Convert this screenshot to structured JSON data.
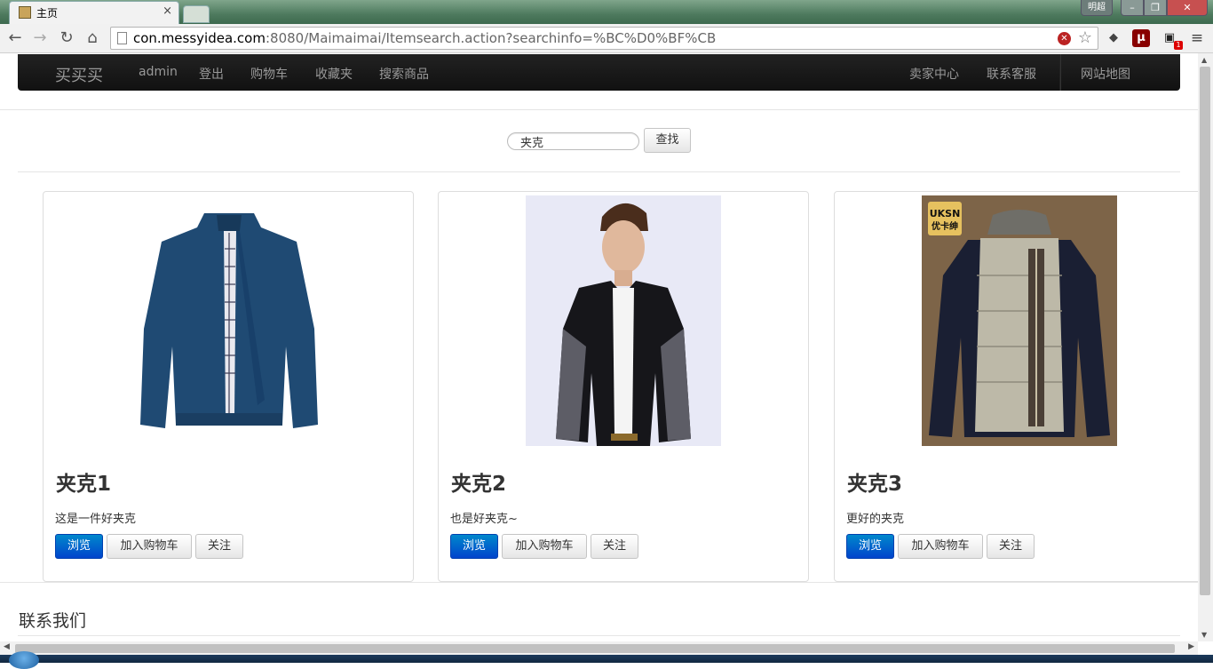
{
  "browser": {
    "tab_title": "主页",
    "tab_close": "×",
    "user_button": "明超",
    "window_min": "–",
    "window_max": "❐",
    "window_close": "✕",
    "back": "←",
    "forward": "→",
    "reload": "↻",
    "home": "⌂",
    "url_host": "con.messyidea.com",
    "url_rest": ":8080/Maimaimai/Itemsearch.action?searchinfo=%BC%D0%BF%CB",
    "ublock_label": "μ",
    "mail_badge": "1",
    "menu_glyph": "≡"
  },
  "navbar": {
    "brand": "买买买",
    "left_items": [
      "admin",
      "登出",
      "购物车",
      "收藏夹",
      "搜索商品"
    ],
    "right_items": [
      "卖家中心",
      "联系客服",
      "网站地图"
    ]
  },
  "search": {
    "value": "夹克",
    "button_label": "查找"
  },
  "products": [
    {
      "title": "夹克1",
      "description": "这是一件好夹克",
      "image": "navy-zip-jacket"
    },
    {
      "title": "夹克2",
      "description": "也是好夹克~",
      "image": "leather-jacket-model"
    },
    {
      "title": "夹克3",
      "description": "更好的夹克",
      "image": "padded-jacket",
      "brand_logo": "UKSN\n优卡绅"
    }
  ],
  "product_actions": {
    "view": "浏览",
    "add_to_cart": "加入购物车",
    "follow": "关注"
  },
  "footer": {
    "title": "联系我们"
  }
}
